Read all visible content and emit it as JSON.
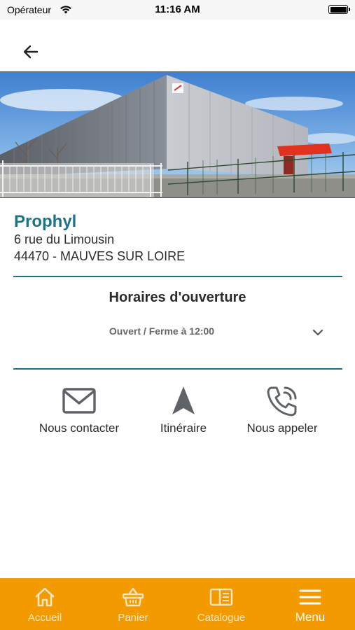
{
  "status_bar": {
    "carrier": "Opérateur",
    "time": "11:16 AM"
  },
  "store": {
    "name": "Prophyl",
    "street": "6 rue du Limousin",
    "city_line": "44470 - MAUVES SUR LOIRE"
  },
  "hours": {
    "title": "Horaires d'ouverture",
    "status": "Ouvert / Ferme à 12:00"
  },
  "actions": {
    "contact_label": "Nous contacter",
    "route_label": "Itinéraire",
    "call_label": "Nous appeler"
  },
  "tabs": {
    "home_label": "Accueil",
    "cart_label": "Panier",
    "catalog_label": "Catalogue",
    "menu_label": "Menu",
    "active": "menu"
  },
  "colors": {
    "accent_teal": "#1c7388",
    "tab_bar_orange": "#f29a00",
    "icon_gray": "#5f6368"
  }
}
